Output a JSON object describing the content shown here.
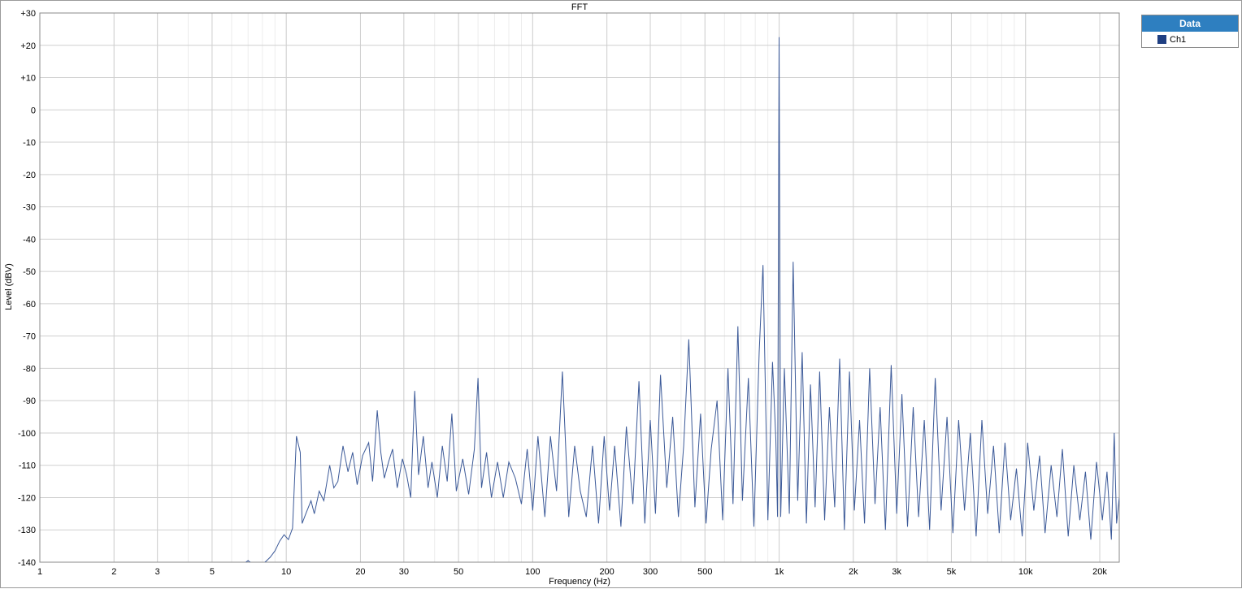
{
  "legend": {
    "title": "Data",
    "items": [
      {
        "label": "Ch1",
        "color": "#1f3f82"
      }
    ]
  },
  "chart_data": {
    "type": "line",
    "title": "FFT",
    "xlabel": "Frequency (Hz)",
    "ylabel": "Level (dBV)",
    "xscale": "log",
    "xlim": [
      1,
      24000
    ],
    "ylim": [
      -140,
      30
    ],
    "grid": true,
    "legend_position": "top-right",
    "x_ticks": [
      {
        "value": 1,
        "label": "1"
      },
      {
        "value": 2,
        "label": "2"
      },
      {
        "value": 3,
        "label": "3"
      },
      {
        "value": 5,
        "label": "5"
      },
      {
        "value": 10,
        "label": "10"
      },
      {
        "value": 20,
        "label": "20"
      },
      {
        "value": 30,
        "label": "30"
      },
      {
        "value": 50,
        "label": "50"
      },
      {
        "value": 100,
        "label": "100"
      },
      {
        "value": 200,
        "label": "200"
      },
      {
        "value": 300,
        "label": "300"
      },
      {
        "value": 500,
        "label": "500"
      },
      {
        "value": 1000,
        "label": "1k"
      },
      {
        "value": 2000,
        "label": "2k"
      },
      {
        "value": 3000,
        "label": "3k"
      },
      {
        "value": 5000,
        "label": "5k"
      },
      {
        "value": 10000,
        "label": "10k"
      },
      {
        "value": 20000,
        "label": "20k"
      }
    ],
    "y_ticks": [
      {
        "value": 30,
        "label": "+30"
      },
      {
        "value": 20,
        "label": "+20"
      },
      {
        "value": 10,
        "label": "+10"
      },
      {
        "value": 0,
        "label": "0"
      },
      {
        "value": -10,
        "label": "-10"
      },
      {
        "value": -20,
        "label": "-20"
      },
      {
        "value": -30,
        "label": "-30"
      },
      {
        "value": -40,
        "label": "-40"
      },
      {
        "value": -50,
        "label": "-50"
      },
      {
        "value": -60,
        "label": "-60"
      },
      {
        "value": -70,
        "label": "-70"
      },
      {
        "value": -80,
        "label": "-80"
      },
      {
        "value": -90,
        "label": "-90"
      },
      {
        "value": -100,
        "label": "-100"
      },
      {
        "value": -110,
        "label": "-110"
      },
      {
        "value": -120,
        "label": "-120"
      },
      {
        "value": -130,
        "label": "-130"
      },
      {
        "value": -140,
        "label": "-140"
      }
    ],
    "series": [
      {
        "name": "Ch1",
        "color": "#3b5998",
        "points": [
          [
            6.6,
            -141
          ],
          [
            7.0,
            -139.5
          ],
          [
            7.4,
            -141
          ],
          [
            7.8,
            -142
          ],
          [
            8.2,
            -140
          ],
          [
            8.6,
            -138.5
          ],
          [
            9.0,
            -136.5
          ],
          [
            9.4,
            -133.5
          ],
          [
            9.8,
            -131.5
          ],
          [
            10.2,
            -133
          ],
          [
            10.6,
            -129.5
          ],
          [
            11.0,
            -101
          ],
          [
            11.4,
            -106
          ],
          [
            11.6,
            -128
          ],
          [
            12.0,
            -125
          ],
          [
            12.6,
            -121
          ],
          [
            13.0,
            -125
          ],
          [
            13.6,
            -118
          ],
          [
            14.2,
            -121
          ],
          [
            15.0,
            -110
          ],
          [
            15.6,
            -117
          ],
          [
            16.2,
            -115
          ],
          [
            17.0,
            -104
          ],
          [
            17.8,
            -112
          ],
          [
            18.6,
            -106
          ],
          [
            19.4,
            -116
          ],
          [
            20.4,
            -107
          ],
          [
            21.6,
            -103
          ],
          [
            22.4,
            -115
          ],
          [
            23.4,
            -93
          ],
          [
            24.2,
            -106
          ],
          [
            25.0,
            -114
          ],
          [
            26.0,
            -109
          ],
          [
            27.0,
            -105
          ],
          [
            28.2,
            -117
          ],
          [
            29.6,
            -108
          ],
          [
            30.8,
            -113
          ],
          [
            32.0,
            -120
          ],
          [
            33.2,
            -87
          ],
          [
            34.4,
            -113
          ],
          [
            36.0,
            -101
          ],
          [
            37.6,
            -117
          ],
          [
            39.0,
            -109
          ],
          [
            41.0,
            -120
          ],
          [
            43.0,
            -104
          ],
          [
            45.0,
            -115
          ],
          [
            47.0,
            -94
          ],
          [
            49.0,
            -118
          ],
          [
            52.0,
            -108
          ],
          [
            55.0,
            -119
          ],
          [
            58.0,
            -105
          ],
          [
            60.0,
            -83
          ],
          [
            62.0,
            -117
          ],
          [
            65.0,
            -106
          ],
          [
            68.0,
            -120
          ],
          [
            72.0,
            -109
          ],
          [
            76.0,
            -120
          ],
          [
            80.0,
            -109
          ],
          [
            85.0,
            -114
          ],
          [
            90.0,
            -122
          ],
          [
            95.0,
            -105
          ],
          [
            100.0,
            -124
          ],
          [
            105.0,
            -101
          ],
          [
            112.0,
            -126
          ],
          [
            118.0,
            -101
          ],
          [
            125.0,
            -118
          ],
          [
            132.0,
            -81
          ],
          [
            140.0,
            -126
          ],
          [
            148.0,
            -104
          ],
          [
            156.0,
            -118
          ],
          [
            165.0,
            -126
          ],
          [
            175.0,
            -104
          ],
          [
            185.0,
            -128
          ],
          [
            195.0,
            -101
          ],
          [
            205.0,
            -124
          ],
          [
            215.0,
            -104
          ],
          [
            228.0,
            -129
          ],
          [
            240.0,
            -98
          ],
          [
            255.0,
            -122
          ],
          [
            270.0,
            -84
          ],
          [
            285.0,
            -128
          ],
          [
            300.0,
            -96
          ],
          [
            315.0,
            -125
          ],
          [
            330.0,
            -82
          ],
          [
            350.0,
            -117
          ],
          [
            370.0,
            -95
          ],
          [
            390.0,
            -126
          ],
          [
            410.0,
            -104
          ],
          [
            430.0,
            -71
          ],
          [
            455.0,
            -123
          ],
          [
            480.0,
            -94
          ],
          [
            505.0,
            -128
          ],
          [
            530.0,
            -105
          ],
          [
            560.0,
            -90
          ],
          [
            590.0,
            -127
          ],
          [
            620.0,
            -80
          ],
          [
            650.0,
            -122
          ],
          [
            680.0,
            -67
          ],
          [
            710.0,
            -121
          ],
          [
            750.0,
            -83
          ],
          [
            790.0,
            -129
          ],
          [
            830.0,
            -75
          ],
          [
            860.0,
            -48
          ],
          [
            900.0,
            -127
          ],
          [
            940.0,
            -78
          ],
          [
            970.0,
            -102
          ],
          [
            985.0,
            -126
          ],
          [
            1000.0,
            22.5
          ],
          [
            1015.0,
            -126
          ],
          [
            1050.0,
            -80
          ],
          [
            1100.0,
            -125
          ],
          [
            1140.0,
            -47
          ],
          [
            1190.0,
            -121
          ],
          [
            1240.0,
            -75
          ],
          [
            1290.0,
            -128
          ],
          [
            1340.0,
            -85
          ],
          [
            1400.0,
            -123
          ],
          [
            1460.0,
            -81
          ],
          [
            1530.0,
            -127
          ],
          [
            1600.0,
            -92
          ],
          [
            1680.0,
            -123
          ],
          [
            1760.0,
            -77
          ],
          [
            1840.0,
            -130
          ],
          [
            1930.0,
            -81
          ],
          [
            2020.0,
            -124
          ],
          [
            2120.0,
            -96
          ],
          [
            2220.0,
            -128
          ],
          [
            2330.0,
            -80
          ],
          [
            2450.0,
            -122
          ],
          [
            2570.0,
            -92
          ],
          [
            2700.0,
            -130
          ],
          [
            2850.0,
            -79
          ],
          [
            3000.0,
            -125
          ],
          [
            3150.0,
            -88
          ],
          [
            3320.0,
            -129
          ],
          [
            3500.0,
            -92
          ],
          [
            3680.0,
            -126
          ],
          [
            3880.0,
            -96
          ],
          [
            4080.0,
            -130
          ],
          [
            4300.0,
            -83
          ],
          [
            4540.0,
            -124
          ],
          [
            4800.0,
            -95
          ],
          [
            5070.0,
            -131
          ],
          [
            5350.0,
            -96
          ],
          [
            5650.0,
            -124
          ],
          [
            5970.0,
            -100
          ],
          [
            6300.0,
            -132
          ],
          [
            6650.0,
            -96
          ],
          [
            7020.0,
            -125
          ],
          [
            7410.0,
            -104
          ],
          [
            7820.0,
            -131
          ],
          [
            8250.0,
            -103
          ],
          [
            8700.0,
            -127
          ],
          [
            9180.0,
            -111
          ],
          [
            9690.0,
            -132
          ],
          [
            10200.0,
            -103
          ],
          [
            10800.0,
            -124
          ],
          [
            11400.0,
            -107
          ],
          [
            12000.0,
            -131
          ],
          [
            12700.0,
            -110
          ],
          [
            13400.0,
            -126
          ],
          [
            14100.0,
            -105
          ],
          [
            14900.0,
            -132
          ],
          [
            15700.0,
            -110
          ],
          [
            16600.0,
            -127
          ],
          [
            17500.0,
            -112
          ],
          [
            18400.0,
            -133
          ],
          [
            19400.0,
            -109
          ],
          [
            20500.0,
            -127
          ],
          [
            21400.0,
            -112
          ],
          [
            22300.0,
            -133
          ],
          [
            22900.0,
            -100
          ],
          [
            23400.0,
            -128
          ],
          [
            24000.0,
            -120
          ]
        ]
      }
    ]
  }
}
